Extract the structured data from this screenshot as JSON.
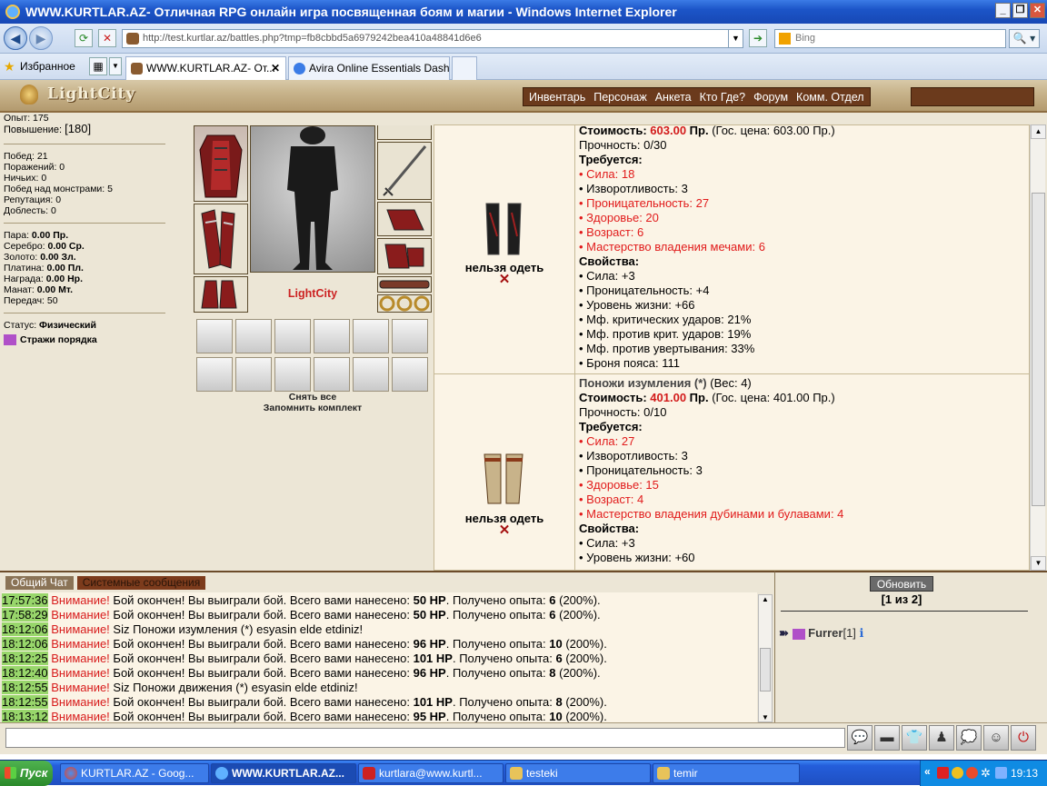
{
  "window": {
    "title": "WWW.KURTLAR.AZ- Отличная RPG онлайн игра посвященная боям и магии - Windows Internet Explorer",
    "btn_min": "_",
    "btn_max": "❐",
    "btn_close": "✕"
  },
  "address": {
    "back": "◀",
    "forward": "▶",
    "url": "http://test.kurtlar.az/battles.php?tmp=fb8cbbd5a6979242bea410a48841d6e6",
    "search_placeholder": "Bing",
    "go": "➔",
    "search_btn": "🔍 ▾"
  },
  "tabs": {
    "favorites": "Избранное",
    "items": [
      {
        "label": "WWW.KURTLAR.AZ- От...",
        "close": "✕"
      },
      {
        "label": "Avira Online Essentials Dash..."
      }
    ]
  },
  "game": {
    "logo": "LightCity",
    "menu": [
      "Инвентарь",
      "Персонаж",
      "Анкета",
      "Кто Где?",
      "Форум",
      "Комм. Отдел"
    ],
    "stats": {
      "top_cut": "Опыт: 175",
      "upgrade_label": "Повышение:",
      "upgrade_value": "[180]",
      "lines1": [
        "Побед: 21",
        "Поражений: 0",
        "Ничьих: 0",
        "Побед над монстрами: 5",
        "Репутация: 0",
        "Доблесть: 0"
      ],
      "money": [
        {
          "label": "Пара:",
          "value": "0.00 Пр."
        },
        {
          "label": "Серебро:",
          "value": "0.00 Ср."
        },
        {
          "label": "Золото:",
          "value": "0.00 Зл."
        },
        {
          "label": "Платина:",
          "value": "0.00 Пл."
        },
        {
          "label": "Награда:",
          "value": "0.00 Нр."
        },
        {
          "label": "Манат:",
          "value": "0.00 Мт."
        }
      ],
      "transfers": "Передач: 50",
      "status_label": "Статус:",
      "status_value": "Физический",
      "clan": "Стражи порядка"
    },
    "char_name": "LightCity",
    "unequip_all": "Снять все",
    "save_set": "Запомнить комплект",
    "items": [
      {
        "name": "",
        "cost_label": "Стоимость:",
        "cost": "603.00",
        "cost_unit": "Пр.",
        "gov_price": "(Гос. цена: 603.00 Пр.)",
        "durability": "Прочность: 0/30",
        "cannot": "нельзя одеть",
        "req_title": "Требуется:",
        "reqs": [
          {
            "text": "Сила: 18",
            "red": true
          },
          {
            "text": "Изворотливость: 3",
            "red": false
          },
          {
            "text": "Проницательность: 27",
            "red": true
          },
          {
            "text": "Здоровье: 20",
            "red": true
          },
          {
            "text": "Возраст: 6",
            "red": true
          },
          {
            "text": "Мастерство владения мечами: 6",
            "red": true
          }
        ],
        "props_title": "Свойства:",
        "props": [
          "Сила: +3",
          "Проницательность: +4",
          "Уровень жизни: +66",
          "Мф. критических ударов: 21%",
          "Мф. против крит. ударов: 19%",
          "Мф. против увертывания: 33%",
          "Броня пояса: 111"
        ]
      },
      {
        "name": "Поножи изумления (*)",
        "weight": "(Вес: 4)",
        "cost_label": "Стоимость:",
        "cost": "401.00",
        "cost_unit": "Пр.",
        "gov_price": "(Гос. цена: 401.00 Пр.)",
        "durability": "Прочность: 0/10",
        "cannot": "нельзя одеть",
        "req_title": "Требуется:",
        "reqs": [
          {
            "text": "Сила: 27",
            "red": true
          },
          {
            "text": "Изворотливость: 3",
            "red": false
          },
          {
            "text": "Проницательность: 3",
            "red": false
          },
          {
            "text": "Здоровье: 15",
            "red": true
          },
          {
            "text": "Возраст: 4",
            "red": true
          },
          {
            "text": "Мастерство владения дубинами и булавами: 4",
            "red": true
          }
        ],
        "props_title": "Свойства:",
        "props": [
          "Сила: +3",
          "Уровень жизни: +60"
        ]
      }
    ],
    "chat": {
      "tab_general": "Общий Чат",
      "tab_system": "Системные сообщения",
      "lines": [
        {
          "time": "17:57:36",
          "warn": "Внимание!",
          "pre": "Бой окончен! Вы выиграли бой. Всего вами нанесено:",
          "hp": "50 HP",
          "mid": ". Получено опыта:",
          "exp": "6",
          "post": "(200%)."
        },
        {
          "time": "17:58:29",
          "warn": "Внимание!",
          "pre": "Бой окончен! Вы выиграли бой. Всего вами нанесено:",
          "hp": "50 HP",
          "mid": ". Получено опыта:",
          "exp": "6",
          "post": "(200%)."
        },
        {
          "time": "18:12:06",
          "warn": "Внимание!",
          "pre": "Siz Поножи изумления (*) esyasin elde etdiniz!",
          "hp": "",
          "mid": "",
          "exp": "",
          "post": ""
        },
        {
          "time": "18:12:06",
          "warn": "Внимание!",
          "pre": "Бой окончен! Вы выиграли бой. Всего вами нанесено:",
          "hp": "96 HP",
          "mid": ". Получено опыта:",
          "exp": "10",
          "post": "(200%)."
        },
        {
          "time": "18:12:25",
          "warn": "Внимание!",
          "pre": "Бой окончен! Вы выиграли бой. Всего вами нанесено:",
          "hp": "101 HP",
          "mid": ". Получено опыта:",
          "exp": "6",
          "post": "(200%)."
        },
        {
          "time": "18:12:40",
          "warn": "Внимание!",
          "pre": "Бой окончен! Вы выиграли бой. Всего вами нанесено:",
          "hp": "96 HP",
          "mid": ". Получено опыта:",
          "exp": "8",
          "post": "(200%)."
        },
        {
          "time": "18:12:55",
          "warn": "Внимание!",
          "pre": "Siz Поножи движения (*) esyasin elde etdiniz!",
          "hp": "",
          "mid": "",
          "exp": "",
          "post": ""
        },
        {
          "time": "18:12:55",
          "warn": "Внимание!",
          "pre": "Бой окончен! Вы выиграли бой. Всего вами нанесено:",
          "hp": "101 HP",
          "mid": ". Получено опыта:",
          "exp": "8",
          "post": "(200%)."
        },
        {
          "time": "18:13:12",
          "warn": "Внимание!",
          "pre": "Бой окончен! Вы выиграли бой. Всего вами нанесено:",
          "hp": "95 HP",
          "mid": ". Получено опыта:",
          "exp": "10",
          "post": "(200%)."
        }
      ]
    },
    "online": {
      "refresh": "Обновить",
      "page": "[1 из 2]",
      "player": "Furrer",
      "player_level": "[1]",
      "info": "ℹ"
    },
    "input_buttons": [
      "💬",
      "▬",
      "👕",
      "♟",
      "💭",
      "☺",
      "⏻"
    ]
  },
  "taskbar": {
    "start": "Пуск",
    "items": [
      "KURTLAR.AZ - Goog...",
      "WWW.KURTLAR.AZ...",
      "kurtlara@www.kurtl...",
      "testeki",
      "temir"
    ],
    "tray_arrow": "«",
    "clock": "19:13"
  }
}
